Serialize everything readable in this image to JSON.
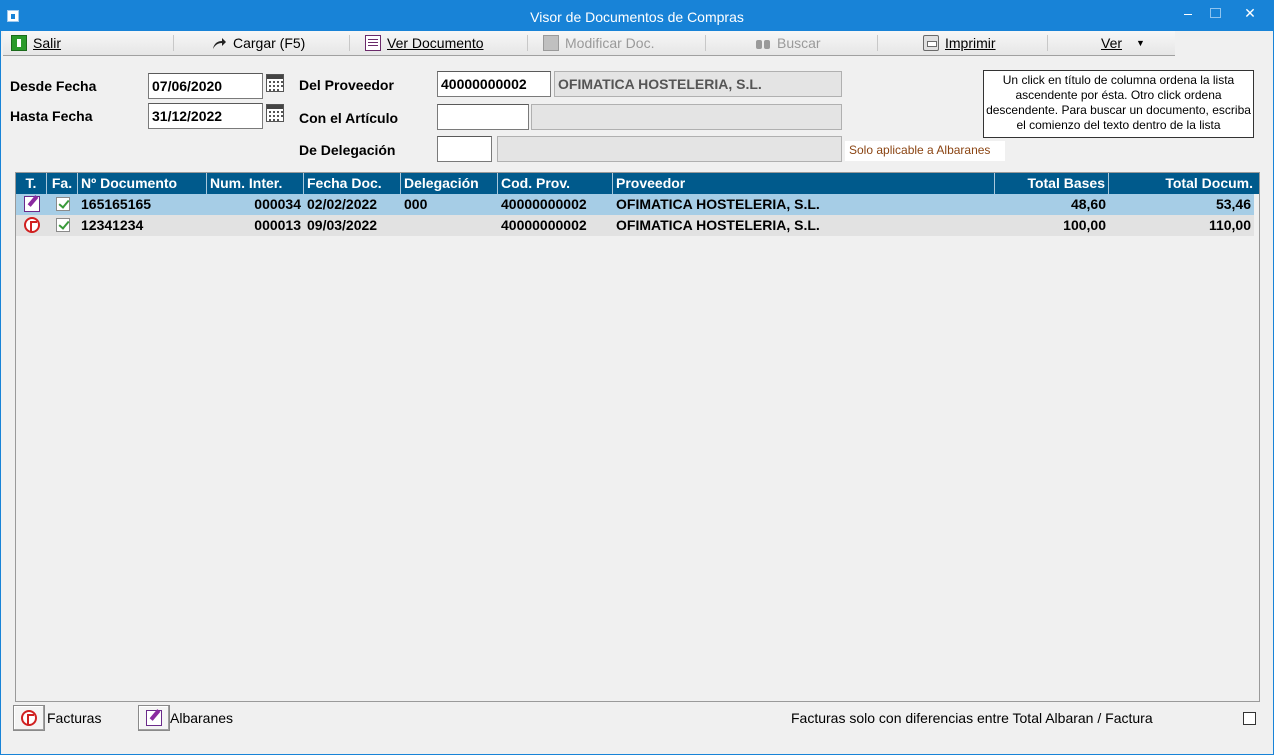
{
  "window": {
    "title": "Visor de Documentos de Compras"
  },
  "toolbar": {
    "salir": "Salir",
    "cargar": "Cargar (F5)",
    "ver_documento": "Ver Documento",
    "modificar": "Modificar Doc.",
    "buscar": "Buscar",
    "imprimir": "Imprimir",
    "ver": "Ver"
  },
  "form": {
    "desde_fecha_label": "Desde Fecha",
    "desde_fecha_value": "07/06/2020",
    "hasta_fecha_label": "Hasta Fecha",
    "hasta_fecha_value": "31/12/2022",
    "proveedor_label": "Del Proveedor",
    "proveedor_code": "40000000002",
    "proveedor_name": "OFIMATICA HOSTELERIA, S.L.",
    "articulo_label": "Con el Artículo",
    "articulo_code": "",
    "articulo_name": "",
    "delegacion_label": "De Delegación",
    "delegacion_code": "",
    "delegacion_name": "",
    "delegacion_hint": "Solo aplicable a Albaranes"
  },
  "note": "Un click en título de columna ordena la lista ascendente por ésta. Otro click ordena descendente. Para buscar un documento, escriba el comienzo del texto dentro de la lista",
  "grid": {
    "columns": [
      "T.",
      "Fa.",
      "Nº Documento",
      "Num. Inter.",
      "Fecha Doc.",
      "Delegación",
      "Cod. Prov.",
      "Proveedor",
      "Total Bases",
      "Total Docum."
    ],
    "rows": [
      {
        "type_icon": "albaran-icon",
        "fa_icon": "check-icon",
        "documento": "165165165",
        "num_inter": "000034",
        "fecha": "02/02/2022",
        "delegacion": "000",
        "cod_prov": "40000000002",
        "proveedor": "OFIMATICA HOSTELERIA, S.L.",
        "total_bases": "48,60",
        "total_docum": "53,46"
      },
      {
        "type_icon": "factura-icon",
        "fa_icon": "check-icon",
        "documento": "12341234",
        "num_inter": "000013",
        "fecha": "09/03/2022",
        "delegacion": "",
        "cod_prov": "40000000002",
        "proveedor": "OFIMATICA HOSTELERIA, S.L.",
        "total_bases": "100,00",
        "total_docum": "110,00"
      }
    ]
  },
  "bottom": {
    "facturas_label": "Facturas",
    "albaranes_label": "Albaranes",
    "diferencias_label": "Facturas solo con diferencias entre Total Albaran / Factura"
  },
  "colors": {
    "titlebar": "#1883d7",
    "grid_header": "#005a8c",
    "selected_row": "#a6cde6",
    "hint_text": "#8b4513"
  }
}
